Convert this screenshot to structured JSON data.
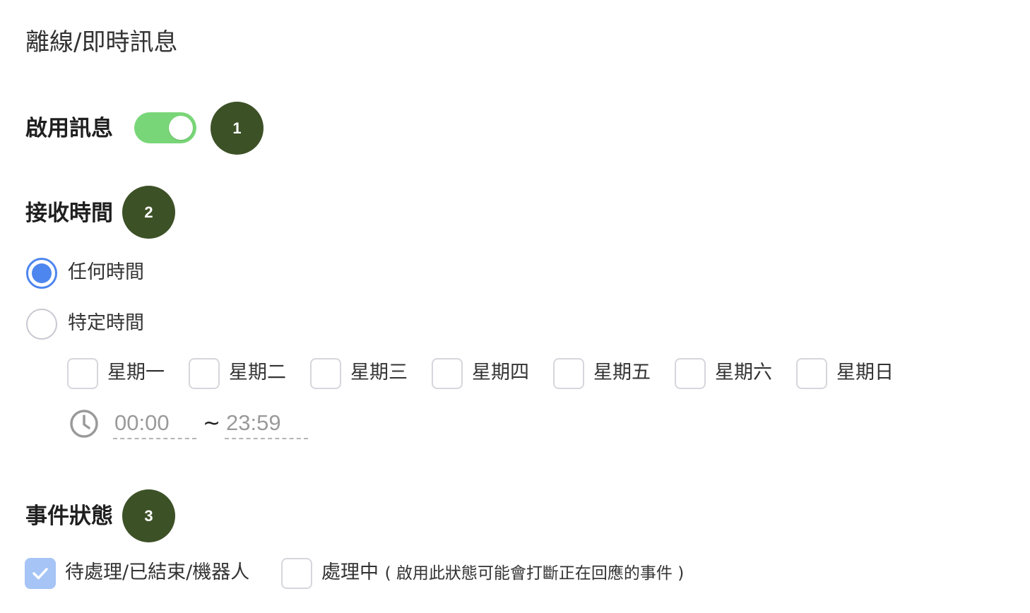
{
  "page": {
    "title": "離線/即時訊息"
  },
  "enable_section": {
    "label": "啟用訊息",
    "toggle_on": true,
    "toggle_color": "#79d678",
    "badge": "1"
  },
  "receive_time": {
    "label": "接收時間",
    "badge": "2",
    "options": [
      {
        "label": "任何時間",
        "selected": true
      },
      {
        "label": "特定時間",
        "selected": false
      }
    ],
    "days": [
      {
        "label": "星期一",
        "checked": false
      },
      {
        "label": "星期二",
        "checked": false
      },
      {
        "label": "星期三",
        "checked": false
      },
      {
        "label": "星期四",
        "checked": false
      },
      {
        "label": "星期五",
        "checked": false
      },
      {
        "label": "星期六",
        "checked": false
      },
      {
        "label": "星期日",
        "checked": false
      }
    ],
    "start_time": "00:00",
    "end_time": "23:59",
    "separator": "~",
    "clock_icon": "clock-icon"
  },
  "event_status": {
    "label": "事件狀態",
    "badge": "3",
    "options": [
      {
        "label": "待處理/已結束/機器人",
        "checked": true
      },
      {
        "label": "處理中",
        "note": "( 啟用此狀態可能會打斷正在回應的事件 )",
        "checked": false
      }
    ]
  },
  "colors": {
    "accent": "#4d86ee",
    "badge_bg": "#3d5127",
    "checkbox_checked": "#a6c4f6"
  }
}
